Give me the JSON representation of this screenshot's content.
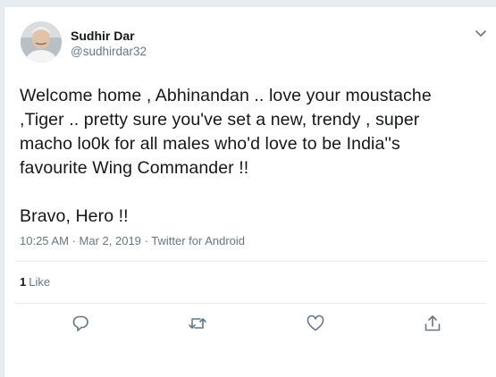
{
  "tweet": {
    "author_name": "Sudhir Dar",
    "author_handle": "@sudhirdar32",
    "text": "Welcome home , Abhinandan .. love your moustache\n,Tiger .. pretty sure  you've set a new, trendy , super\nmacho lo0k for all males who'd love to be India''s\nfavourite Wing Commander !!\n\nBravo, Hero !!",
    "time": "10:25 AM",
    "separator": "·",
    "date": "Mar 2, 2019",
    "source": "Twitter for Android",
    "like_count": "1",
    "like_label": "Like"
  },
  "icons": {
    "menu": "chevron-down-icon",
    "reply": "reply-icon",
    "retweet": "retweet-icon",
    "like": "heart-icon",
    "share": "share-icon"
  },
  "colors": {
    "background": "#e6ecf0",
    "card": "#ffffff",
    "text": "#14171a",
    "secondary_text": "#657786"
  }
}
